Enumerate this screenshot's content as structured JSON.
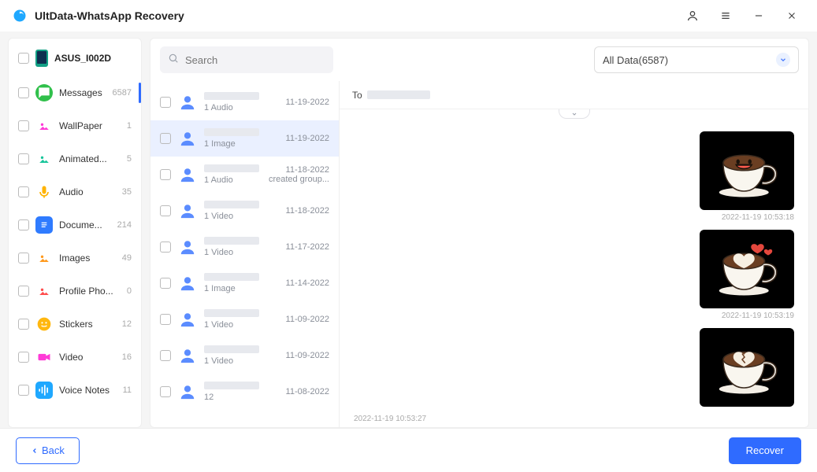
{
  "app": {
    "title": "UltData-WhatsApp Recovery"
  },
  "device": {
    "name": "ASUS_I002D"
  },
  "sidebar": {
    "items": [
      {
        "label": "Messages",
        "count": "6587",
        "iconColor": "#30c04b",
        "glyph": "chat"
      },
      {
        "label": "WallPaper",
        "count": "1",
        "iconColor": "#ff3bd7",
        "glyph": "image",
        "multi": true
      },
      {
        "label": "Animated...",
        "count": "5",
        "iconColor": "#19c59b",
        "glyph": "image"
      },
      {
        "label": "Audio",
        "count": "35",
        "iconColor": "#ffb300",
        "glyph": "mic"
      },
      {
        "label": "Docume...",
        "count": "214",
        "iconColor": "#2f7bff",
        "glyph": "doc"
      },
      {
        "label": "Images",
        "count": "49",
        "iconColor": "#ff9a1e",
        "glyph": "image"
      },
      {
        "label": "Profile Pho...",
        "count": "0",
        "iconColor": "#ff4d4d",
        "glyph": "image"
      },
      {
        "label": "Stickers",
        "count": "12",
        "iconColor": "#ffb70f",
        "glyph": "smile"
      },
      {
        "label": "Video",
        "count": "16",
        "iconColor": "#ff3bd7",
        "glyph": "video"
      },
      {
        "label": "Voice Notes",
        "count": "11",
        "iconColor": "#1fa8ff",
        "glyph": "wave"
      }
    ]
  },
  "toolbar": {
    "search_placeholder": "Search",
    "filter_label": "All Data(6587)"
  },
  "conversations": [
    {
      "sub": "1 Audio",
      "date": "11-19-2022"
    },
    {
      "sub": "1 Image",
      "date": "11-19-2022",
      "selected": true
    },
    {
      "sub": "1 Audio",
      "date": "11-18-2022",
      "extra": "created group..."
    },
    {
      "sub": "1 Video",
      "date": "11-18-2022"
    },
    {
      "sub": "1 Video",
      "date": "11-17-2022"
    },
    {
      "sub": "1 Image",
      "date": "11-14-2022"
    },
    {
      "sub": "1 Video",
      "date": "11-09-2022"
    },
    {
      "sub": "1 Video",
      "date": "11-09-2022"
    },
    {
      "sub": "12",
      "date": "11-08-2022"
    }
  ],
  "chat": {
    "to_label": "To",
    "messages": [
      {
        "kind": "sticker",
        "sticker": "laugh",
        "ts": "2022-11-19 10:53:18"
      },
      {
        "kind": "sticker",
        "sticker": "heart",
        "ts": "2022-11-19 10:53:19"
      },
      {
        "kind": "sticker",
        "sticker": "broken",
        "ts": ""
      }
    ],
    "in_ts": "2022-11-19 10:53:27"
  },
  "footer": {
    "back_label": "Back",
    "recover_label": "Recover"
  }
}
